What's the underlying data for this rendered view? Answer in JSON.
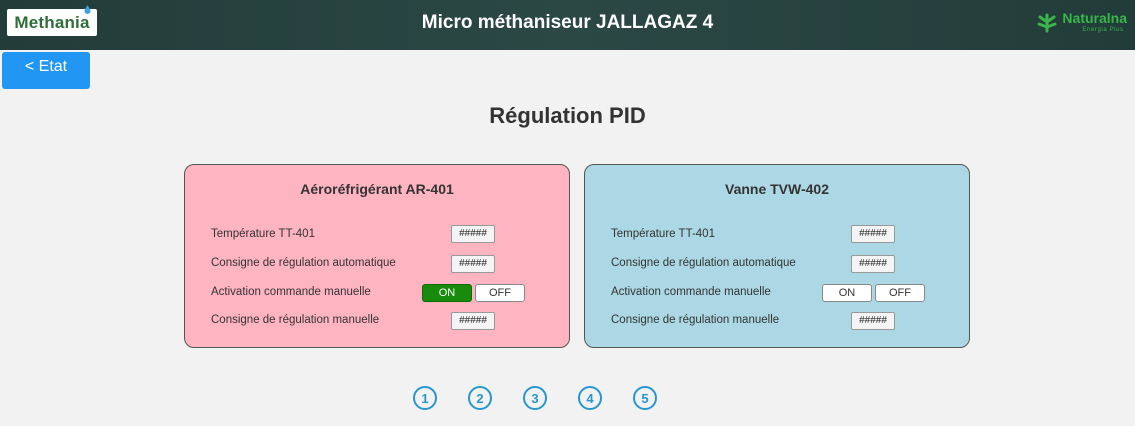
{
  "header": {
    "logo_left": "Methania",
    "title": "Micro méthaniseur JALLAGAZ 4",
    "logo_right_brand": "Naturalna",
    "logo_right_sub": "Energia Plus"
  },
  "nav": {
    "back_label": "< Etat"
  },
  "page": {
    "title": "Régulation PID"
  },
  "panels": [
    {
      "title": "Aéroréfrigérant AR-401",
      "color": "#ffb4c2",
      "rows": {
        "temp_label": "Température TT-401",
        "temp_value": "#####",
        "auto_label": "Consigne de régulation automatique",
        "auto_value": "#####",
        "manual_activation_label": "Activation commande manuelle",
        "on_label": "ON",
        "off_label": "OFF",
        "manual_state": "ON",
        "manual_setpoint_label": "Consigne de régulation manuelle",
        "manual_setpoint_value": "#####"
      }
    },
    {
      "title": "Vanne TVW-402",
      "color": "#acd8e6",
      "rows": {
        "temp_label": "Température TT-401",
        "temp_value": "#####",
        "auto_label": "Consigne de régulation automatique",
        "auto_value": "#####",
        "manual_activation_label": "Activation commande manuelle",
        "on_label": "ON",
        "off_label": "OFF",
        "manual_state": "none",
        "manual_setpoint_label": "Consigne de régulation manuelle",
        "manual_setpoint_value": "#####"
      }
    }
  ],
  "pagination": [
    "1",
    "2",
    "3",
    "4",
    "5"
  ],
  "colors": {
    "header_bg": "#2b4845",
    "accent_blue": "#2196f3",
    "toggle_active": "#188a0c",
    "pagination": "#2897cf",
    "brand_green": "#39b54a"
  }
}
